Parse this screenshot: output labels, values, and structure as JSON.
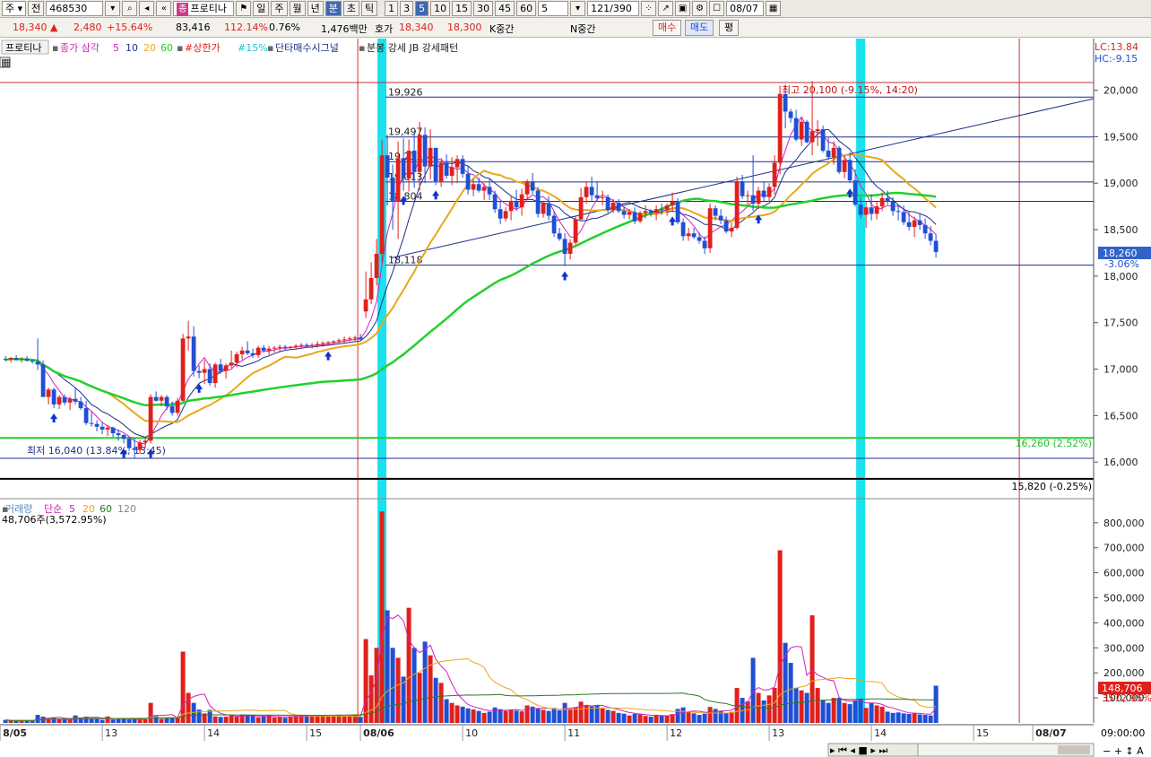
{
  "toolbar": {
    "market": "주",
    "code_prefix": "전",
    "code": "468530",
    "stock_tag": "종",
    "stock_name": "프로티나",
    "period_buttons": [
      "일",
      "주",
      "월",
      "년",
      "분",
      "초",
      "틱"
    ],
    "minute_buttons": [
      "1",
      "3",
      "5",
      "10",
      "15",
      "30",
      "45",
      "60"
    ],
    "interval": "5",
    "count": "121/390",
    "date": "08/07"
  },
  "info": {
    "price": "18,340",
    "change_arrow": "▲",
    "change": "2,480",
    "change_pct": "+15.64%",
    "volume": "83,416",
    "volume_ratio": "112.14%",
    "turnover": "0.76%",
    "amount": "1,476백만",
    "quote_label": "호가",
    "ask": "18,340",
    "bid": "18,300",
    "k_label": "K중간",
    "n_label": "N중간",
    "buy": "매수",
    "sell": "매도",
    "flat": "평"
  },
  "price_legend": {
    "name": "프로티나",
    "ma_label": "종가 삼각",
    "ma_periods": [
      "5",
      "10",
      "20",
      "60"
    ],
    "ceil_label": "#상한가",
    "pct_label": "#15%",
    "signal_label": "단타매수시그널",
    "pattern_label": "분봉 강세 JB 강세패턴"
  },
  "volume_legend": {
    "name": "거래량",
    "type": "단순",
    "periods": [
      "5",
      "20",
      "60",
      "120"
    ],
    "summary": "48,706주(3,572.95%)"
  },
  "corner": {
    "lc": "LC:13.84",
    "hc": "HC:-9.15"
  },
  "colors": {
    "up": "#e0201c",
    "down": "#1f4fd4",
    "ma5": "#d020c0",
    "ma10": "#1c2f8a",
    "ma20": "#e8a81c",
    "ma60": "#22d02c",
    "highlight": "#19e2ee"
  },
  "chart_data": {
    "type": "candlestick",
    "interval_minutes": 5,
    "y_axis": {
      "min": 15800,
      "max": 20100,
      "ticks": [
        16000,
        16500,
        17000,
        17500,
        18000,
        18500,
        19000,
        19500,
        20000
      ]
    },
    "volume_axis": {
      "min": 0,
      "max": 850000,
      "ticks": [
        100000,
        200000,
        300000,
        400000,
        500000,
        600000,
        700000,
        800000
      ]
    },
    "x_labels": [
      "8/05",
      "13",
      "14",
      "15",
      "08/06",
      "10",
      "11",
      "12",
      "13",
      "14",
      "15",
      "08/07"
    ],
    "x_label_bars": [
      0,
      19,
      38,
      57,
      67,
      86,
      105,
      124,
      143,
      162,
      181,
      192
    ],
    "time_label": "09:00:00",
    "h_levels": [
      {
        "label": "19,926",
        "value": 19926
      },
      {
        "label": "19,497",
        "value": 19497
      },
      {
        "label": "19,232",
        "value": 19232
      },
      {
        "label": "19,013",
        "value": 19013
      },
      {
        "label": "18,804",
        "value": 18804
      },
      {
        "label": "18,118",
        "value": 18118
      }
    ],
    "high_annotation": "최고 20,100 (-9.15%, 14:20)",
    "low_annotation": "최저 16,040 (13.84%, 13:45)",
    "green_level": {
      "label": "16,260 (2.52%)",
      "value": 16260
    },
    "black_level": {
      "label": "15,820 (-0.25%)",
      "value": 15820
    },
    "last_price": "18,260",
    "last_pct": "-3.06%",
    "last_volume": "148,706",
    "last_volume_pct": "3572.95%",
    "candles": [
      [
        17110,
        17140,
        17080,
        17100,
        12000
      ],
      [
        17100,
        17130,
        17070,
        17120,
        9000
      ],
      [
        17120,
        17150,
        17090,
        17100,
        8000
      ],
      [
        17100,
        17130,
        17070,
        17110,
        9000
      ],
      [
        17110,
        17140,
        17080,
        17090,
        10000
      ],
      [
        17090,
        17100,
        17060,
        17080,
        9000
      ],
      [
        17080,
        17330,
        16990,
        17050,
        32000
      ],
      [
        17050,
        17090,
        16880,
        16700,
        25000
      ],
      [
        16700,
        16800,
        16620,
        16780,
        18000
      ],
      [
        16780,
        16800,
        16580,
        16620,
        22000
      ],
      [
        16620,
        16720,
        16570,
        16700,
        15000
      ],
      [
        16700,
        16730,
        16610,
        16640,
        16000
      ],
      [
        16640,
        16700,
        16560,
        16680,
        15000
      ],
      [
        16680,
        16800,
        16620,
        16650,
        30000
      ],
      [
        16650,
        16700,
        16560,
        16580,
        22000
      ],
      [
        16580,
        16660,
        16400,
        16420,
        25000
      ],
      [
        16420,
        16540,
        16380,
        16410,
        19000
      ],
      [
        16410,
        16450,
        16330,
        16380,
        18000
      ],
      [
        16380,
        16430,
        16300,
        16350,
        12000
      ],
      [
        16350,
        16400,
        16280,
        16370,
        26000
      ],
      [
        16370,
        16380,
        16270,
        16310,
        14000
      ],
      [
        16310,
        16350,
        16230,
        16290,
        15000
      ],
      [
        16290,
        16300,
        16200,
        16250,
        17000
      ],
      [
        16250,
        16270,
        16120,
        16150,
        14000
      ],
      [
        16150,
        16260,
        16040,
        16130,
        15000
      ],
      [
        16130,
        16240,
        16090,
        16210,
        14000
      ],
      [
        16210,
        16270,
        16150,
        16230,
        14000
      ],
      [
        16230,
        16730,
        16200,
        16700,
        80000
      ],
      [
        16700,
        16760,
        16650,
        16660,
        27000
      ],
      [
        16660,
        16720,
        16600,
        16700,
        16000
      ],
      [
        16700,
        16720,
        16560,
        16600,
        19000
      ],
      [
        16600,
        16650,
        16500,
        16530,
        22000
      ],
      [
        16530,
        16690,
        16500,
        16660,
        21000
      ],
      [
        16660,
        17380,
        16650,
        17330,
        285000
      ],
      [
        17330,
        17520,
        17200,
        17350,
        120000
      ],
      [
        17350,
        17460,
        16920,
        16980,
        80000
      ],
      [
        16980,
        17040,
        16900,
        16960,
        53000
      ],
      [
        16960,
        17100,
        16840,
        17000,
        38000
      ],
      [
        17000,
        17060,
        16820,
        16850,
        52000
      ],
      [
        16850,
        17070,
        16800,
        17050,
        26000
      ],
      [
        17050,
        17110,
        16950,
        16980,
        24000
      ],
      [
        16980,
        17060,
        16900,
        17040,
        25000
      ],
      [
        17040,
        17200,
        17010,
        17070,
        30000
      ],
      [
        17070,
        17190,
        17020,
        17160,
        25000
      ],
      [
        17160,
        17240,
        17100,
        17200,
        34000
      ],
      [
        17200,
        17300,
        17150,
        17170,
        29000
      ],
      [
        17170,
        17220,
        17120,
        17150,
        28000
      ],
      [
        17150,
        17250,
        17120,
        17230,
        23000
      ],
      [
        17230,
        17260,
        17180,
        17200,
        26000
      ],
      [
        17200,
        17250,
        17150,
        17220,
        31000
      ],
      [
        17220,
        17250,
        17180,
        17230,
        22000
      ],
      [
        17230,
        17260,
        17190,
        17240,
        23000
      ],
      [
        17240,
        17260,
        17200,
        17230,
        21000
      ],
      [
        17230,
        17250,
        17210,
        17240,
        26000
      ],
      [
        17240,
        17270,
        17210,
        17250,
        28000
      ],
      [
        17250,
        17280,
        17220,
        17260,
        30000
      ],
      [
        17260,
        17280,
        17230,
        17250,
        29000
      ],
      [
        17250,
        17280,
        17220,
        17260,
        25000
      ],
      [
        17260,
        17300,
        17230,
        17270,
        27000
      ],
      [
        17270,
        17300,
        17240,
        17280,
        26000
      ],
      [
        17280,
        17300,
        17250,
        17290,
        28000
      ],
      [
        17290,
        17310,
        17260,
        17300,
        27000
      ],
      [
        17300,
        17330,
        17280,
        17310,
        30000
      ],
      [
        17310,
        17350,
        17280,
        17320,
        26000
      ],
      [
        17320,
        17350,
        17300,
        17330,
        29000
      ],
      [
        17330,
        17360,
        17300,
        17340,
        31000
      ],
      [
        17340,
        17380,
        17300,
        17320,
        24000
      ],
      [
        17620,
        18050,
        17550,
        17750,
        335000
      ],
      [
        17750,
        18150,
        17700,
        17980,
        190000
      ],
      [
        17980,
        18400,
        17900,
        18240,
        300000
      ],
      [
        18240,
        19460,
        18150,
        19300,
        845000
      ],
      [
        19300,
        19520,
        18760,
        19060,
        450000
      ],
      [
        19060,
        19200,
        18500,
        18800,
        300000
      ],
      [
        18800,
        19450,
        18400,
        19270,
        260000
      ],
      [
        19270,
        19480,
        18920,
        19050,
        185000
      ],
      [
        19050,
        19470,
        18910,
        19350,
        460000
      ],
      [
        19350,
        19540,
        18950,
        19120,
        300000
      ],
      [
        19120,
        19660,
        18920,
        19520,
        200000
      ],
      [
        19520,
        19600,
        19000,
        19180,
        325000
      ],
      [
        19180,
        19580,
        19040,
        19380,
        270000
      ],
      [
        19380,
        19380,
        18980,
        19020,
        180000
      ],
      [
        19020,
        19250,
        18960,
        19220,
        160000
      ],
      [
        19220,
        19310,
        19050,
        19080,
        95000
      ],
      [
        19080,
        19280,
        18980,
        19170,
        80000
      ],
      [
        19170,
        19300,
        19000,
        19260,
        70000
      ],
      [
        19260,
        19300,
        19060,
        19100,
        65000
      ],
      [
        19100,
        19180,
        18880,
        18930,
        58000
      ],
      [
        18930,
        19050,
        18860,
        18990,
        54000
      ],
      [
        18990,
        19060,
        18900,
        18920,
        48000
      ],
      [
        18920,
        19000,
        18820,
        18960,
        40000
      ],
      [
        18960,
        19050,
        18820,
        18880,
        45000
      ],
      [
        18880,
        18920,
        18680,
        18720,
        62000
      ],
      [
        18720,
        18800,
        18560,
        18620,
        55000
      ],
      [
        18620,
        18740,
        18590,
        18700,
        48000
      ],
      [
        18700,
        18860,
        18600,
        18810,
        52000
      ],
      [
        18810,
        18930,
        18700,
        18740,
        49000
      ],
      [
        18740,
        18940,
        18650,
        18880,
        46000
      ],
      [
        18880,
        19040,
        18820,
        19020,
        70000
      ],
      [
        19020,
        19110,
        18880,
        18920,
        65000
      ],
      [
        18920,
        18960,
        18630,
        18670,
        58000
      ],
      [
        18670,
        18800,
        18630,
        18780,
        52000
      ],
      [
        18780,
        18860,
        18600,
        18650,
        48000
      ],
      [
        18650,
        18700,
        18420,
        18460,
        60000
      ],
      [
        18460,
        18520,
        18380,
        18400,
        50000
      ],
      [
        18400,
        18460,
        18110,
        18240,
        80000
      ],
      [
        18240,
        18400,
        18180,
        18360,
        56000
      ],
      [
        18360,
        18650,
        18340,
        18610,
        62000
      ],
      [
        18610,
        18950,
        18600,
        18850,
        85000
      ],
      [
        18850,
        19020,
        18780,
        18960,
        70000
      ],
      [
        18960,
        19070,
        18810,
        18870,
        66000
      ],
      [
        18870,
        19020,
        18800,
        18840,
        70000
      ],
      [
        18840,
        18920,
        18760,
        18850,
        58000
      ],
      [
        18850,
        18880,
        18680,
        18710,
        52000
      ],
      [
        18710,
        18830,
        18680,
        18790,
        48000
      ],
      [
        18790,
        18830,
        18680,
        18700,
        40000
      ],
      [
        18700,
        18750,
        18620,
        18660,
        37000
      ],
      [
        18660,
        18720,
        18610,
        18690,
        30000
      ],
      [
        18690,
        18740,
        18560,
        18590,
        36000
      ],
      [
        18590,
        18700,
        18570,
        18680,
        34000
      ],
      [
        18680,
        18760,
        18620,
        18700,
        28000
      ],
      [
        18700,
        18720,
        18640,
        18680,
        25000
      ],
      [
        18680,
        18760,
        18600,
        18720,
        32000
      ],
      [
        18720,
        18780,
        18660,
        18710,
        30000
      ],
      [
        18710,
        18780,
        18650,
        18760,
        28000
      ],
      [
        18760,
        18900,
        18700,
        18800,
        35000
      ],
      [
        18800,
        18840,
        18560,
        18580,
        56000
      ],
      [
        18580,
        18620,
        18380,
        18430,
        62000
      ],
      [
        18430,
        18520,
        18380,
        18460,
        45000
      ],
      [
        18460,
        18520,
        18400,
        18420,
        38000
      ],
      [
        18420,
        18470,
        18350,
        18380,
        32000
      ],
      [
        18380,
        18430,
        18240,
        18300,
        36000
      ],
      [
        18300,
        18780,
        18250,
        18730,
        64000
      ],
      [
        18730,
        18760,
        18600,
        18650,
        56000
      ],
      [
        18650,
        18720,
        18560,
        18600,
        48000
      ],
      [
        18600,
        18640,
        18460,
        18480,
        40000
      ],
      [
        18480,
        18580,
        18420,
        18520,
        44000
      ],
      [
        18520,
        19070,
        18500,
        19020,
        140000
      ],
      [
        19020,
        19090,
        18830,
        18860,
        100000
      ],
      [
        18860,
        18920,
        18760,
        18870,
        86000
      ],
      [
        18870,
        19300,
        18700,
        18780,
        260000
      ],
      [
        18780,
        18960,
        18720,
        18920,
        120000
      ],
      [
        18920,
        19020,
        18810,
        18850,
        90000
      ],
      [
        18850,
        19000,
        18800,
        18960,
        110000
      ],
      [
        18960,
        19300,
        18880,
        19220,
        140000
      ],
      [
        19220,
        20050,
        19100,
        19960,
        690000
      ],
      [
        19960,
        20060,
        19590,
        19770,
        320000
      ],
      [
        19770,
        19800,
        19650,
        19700,
        240000
      ],
      [
        19700,
        19790,
        19450,
        19470,
        140000
      ],
      [
        19470,
        19700,
        19400,
        19660,
        130000
      ],
      [
        19660,
        19680,
        19430,
        19440,
        120000
      ],
      [
        19440,
        20100,
        19300,
        19560,
        430000
      ],
      [
        19560,
        19680,
        19400,
        19580,
        140000
      ],
      [
        19580,
        19620,
        19330,
        19350,
        90000
      ],
      [
        19350,
        19500,
        19250,
        19280,
        80000
      ],
      [
        19280,
        19450,
        19200,
        19380,
        100000
      ],
      [
        19380,
        19400,
        19100,
        19120,
        100000
      ],
      [
        19120,
        19300,
        19050,
        19250,
        80000
      ],
      [
        19250,
        19330,
        19000,
        19030,
        75000
      ],
      [
        19030,
        19150,
        18750,
        18770,
        90000
      ],
      [
        18770,
        18850,
        18620,
        18660,
        95000
      ],
      [
        18660,
        18800,
        18520,
        18740,
        60000
      ],
      [
        18740,
        18880,
        18600,
        18670,
        80000
      ],
      [
        18670,
        18800,
        18610,
        18750,
        70000
      ],
      [
        18750,
        18900,
        18700,
        18840,
        65000
      ],
      [
        18840,
        18920,
        18770,
        18800,
        45000
      ],
      [
        18800,
        18850,
        18650,
        18700,
        40000
      ],
      [
        18700,
        18760,
        18600,
        18690,
        42000
      ],
      [
        18690,
        18760,
        18550,
        18580,
        38000
      ],
      [
        18580,
        18700,
        18490,
        18530,
        36000
      ],
      [
        18530,
        18640,
        18420,
        18600,
        40000
      ],
      [
        18600,
        18680,
        18500,
        18550,
        34000
      ],
      [
        18550,
        18620,
        18400,
        18460,
        32000
      ],
      [
        18460,
        18540,
        18330,
        18380,
        30000
      ],
      [
        18380,
        18450,
        18200,
        18260,
        148706
      ]
    ],
    "buy_signal_bars": [
      9,
      22,
      27,
      36,
      60,
      74,
      80,
      104,
      124,
      140,
      157
    ],
    "highlight_bars": [
      70,
      159
    ],
    "vertical_lines": [
      66,
      189
    ],
    "channel_line": {
      "from": [
        60,
        18118
      ],
      "to": [
        195,
        19926
      ]
    }
  }
}
